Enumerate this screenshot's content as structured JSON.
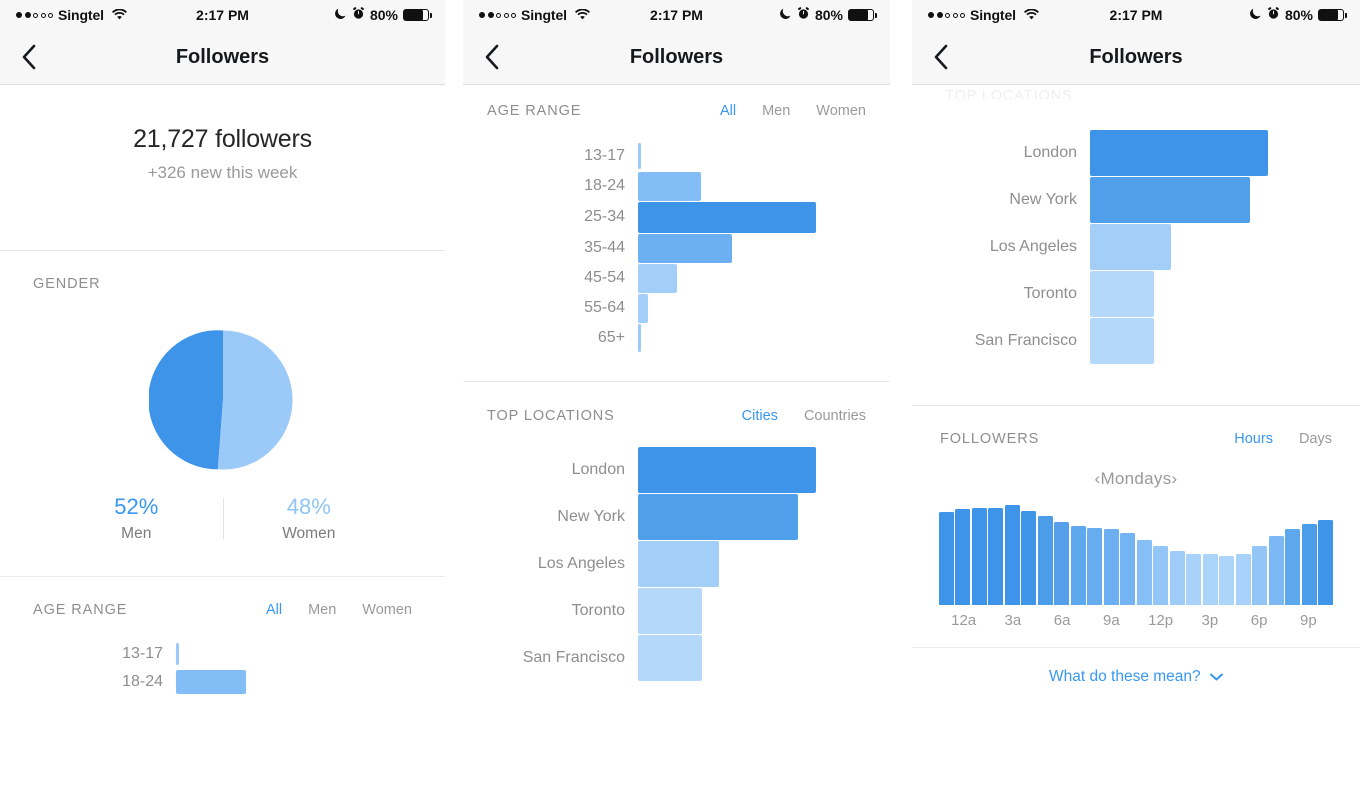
{
  "colors": {
    "accent": "#3897f0",
    "bar_dark": "#3d94e8",
    "bar_mid": "#6cb0f2",
    "bar_light": "#a3cef8",
    "text_muted": "#8e8e8e",
    "status_bg": "#f7f7f7"
  },
  "status_bar": {
    "carrier": "Singtel",
    "time": "2:17 PM",
    "battery_pct": "80%",
    "signal_filled": 2,
    "signal_empty": 3,
    "icons": [
      "wifi-icon",
      "moon-icon",
      "alarm-icon",
      "battery-icon"
    ]
  },
  "nav": {
    "title": "Followers",
    "back_icon": "chevron-left-icon"
  },
  "screen1": {
    "summary": {
      "count": "21,727 followers",
      "delta": "+326 new this week"
    },
    "gender": {
      "title": "GENDER",
      "men_pct": "52%",
      "men_label": "Men",
      "women_pct": "48%",
      "women_label": "Women"
    },
    "age_range": {
      "title": "AGE RANGE",
      "tabs": [
        "All",
        "Men",
        "Women"
      ],
      "active_tab": "All",
      "rows": [
        {
          "label": "13-17"
        },
        {
          "label": "18-24"
        }
      ]
    }
  },
  "screen2": {
    "age_range": {
      "title": "AGE RANGE",
      "tabs": [
        "All",
        "Men",
        "Women"
      ],
      "active_tab": "All"
    },
    "top_locations": {
      "title": "TOP LOCATIONS",
      "tabs": [
        "Cities",
        "Countries"
      ],
      "active_tab": "Cities"
    }
  },
  "screen3": {
    "ghost_title": "TOP LOCATIONS",
    "followers": {
      "title": "FOLLOWERS",
      "tabs": [
        "Hours",
        "Days"
      ],
      "active_tab": "Hours",
      "day_selector": "Mondays",
      "prev_icon": "chevron-left-icon",
      "next_icon": "chevron-right-icon"
    },
    "footer_link": {
      "label": "What do these mean?",
      "icon": "chevron-down-icon"
    }
  },
  "chart_data": [
    {
      "id": "gender_pie",
      "type": "pie",
      "title": "GENDER",
      "categories": [
        "Men",
        "Women"
      ],
      "values": [
        52,
        48
      ],
      "unit": "%",
      "colors": [
        "#3d94e8",
        "#9bcaf8"
      ],
      "legend": "below"
    },
    {
      "id": "age_range_full",
      "type": "bar",
      "orientation": "horizontal",
      "title": "AGE RANGE",
      "categories": [
        "13-17",
        "18-24",
        "25-34",
        "35-44",
        "45-54",
        "55-64",
        "65+"
      ],
      "values": [
        1.5,
        35,
        100,
        53,
        22,
        6,
        1.5
      ],
      "value_unit": "relative % of max",
      "bar_colors": [
        "#9bcaf8",
        "#82bef5",
        "#3d94e8",
        "#6cb0f2",
        "#a3cef8",
        "#a3cef8",
        "#9bcaf8"
      ],
      "xlabel": "",
      "ylabel": "",
      "grid": false
    },
    {
      "id": "age_range_partial",
      "type": "bar",
      "orientation": "horizontal",
      "title": "AGE RANGE",
      "categories": [
        "13-17",
        "18-24"
      ],
      "values": [
        1.5,
        35
      ],
      "value_unit": "relative % of max",
      "bar_colors": [
        "#9bcaf8",
        "#82bef5"
      ],
      "grid": false
    },
    {
      "id": "top_locations_cities",
      "type": "bar",
      "orientation": "horizontal",
      "title": "TOP LOCATIONS",
      "categories": [
        "London",
        "New York",
        "Los Angeles",
        "Toronto",
        "San Francisco"
      ],
      "values": [
        100,
        90,
        45,
        36,
        36
      ],
      "value_unit": "relative % of max",
      "bar_colors": [
        "#3d94e8",
        "#4f9fea",
        "#a3cef8",
        "#b4d8fa",
        "#b4d8fa"
      ],
      "grid": false
    },
    {
      "id": "followers_by_hour",
      "type": "bar",
      "orientation": "vertical",
      "title": "FOLLOWERS",
      "subtitle": "Mondays",
      "categories": [
        "12a",
        "1a",
        "2a",
        "3a",
        "4a",
        "5a",
        "6a",
        "7a",
        "8a",
        "9a",
        "10a",
        "11a",
        "12p",
        "1p",
        "2p",
        "3p",
        "4p",
        "5p",
        "6p",
        "7p",
        "8p",
        "9p",
        "10p",
        "11p"
      ],
      "tick_labels": [
        "12a",
        "3a",
        "6a",
        "9a",
        "12p",
        "3p",
        "6p",
        "9p"
      ],
      "values": [
        93,
        96,
        97,
        97,
        100,
        94,
        89,
        83,
        79,
        77,
        76,
        72,
        65,
        59,
        54,
        51,
        51,
        49,
        51,
        59,
        69,
        76,
        81,
        85
      ],
      "value_unit": "relative % of max",
      "bar_colors": [
        "#3d94e8",
        "#3d94e8",
        "#3d94e8",
        "#3d94e8",
        "#3d94e8",
        "#3f95e8",
        "#4b9ce9",
        "#569fea",
        "#5ea8ed",
        "#66acee",
        "#6cb0f2",
        "#74b4f3",
        "#85bff5",
        "#93c6f7",
        "#9ecbf8",
        "#a8d2f9",
        "#abd4f9",
        "#add5fa",
        "#a8d2f9",
        "#93c6f7",
        "#7cb9f4",
        "#5ea8ed",
        "#4b9ce9",
        "#3f95e8"
      ],
      "grid": false
    }
  ]
}
